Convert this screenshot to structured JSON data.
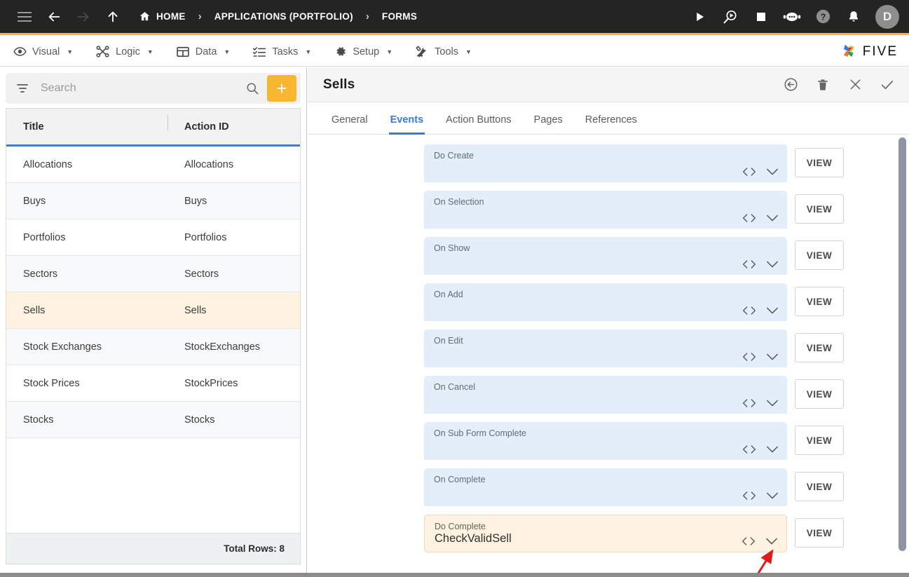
{
  "topbar": {
    "menu_icon": "hamburger-icon",
    "back_icon": "back-arrow-icon",
    "forward_icon": "forward-arrow-icon",
    "up_icon": "up-arrow-icon",
    "breadcrumbs": [
      {
        "label": "HOME",
        "icon": "home-icon"
      },
      {
        "label": "APPLICATIONS (PORTFOLIO)",
        "icon": ""
      },
      {
        "label": "FORMS",
        "icon": ""
      }
    ],
    "separator": "›",
    "right_icons": [
      {
        "name": "run-icon"
      },
      {
        "name": "debug-run-icon"
      },
      {
        "name": "stop-icon"
      },
      {
        "name": "chatbot-icon"
      },
      {
        "name": "help-icon"
      },
      {
        "name": "notifications-bell-icon"
      }
    ],
    "avatar_initial": "D",
    "accent_color": "#f2b731",
    "bar_color": "#242424"
  },
  "menubar": {
    "items": [
      {
        "label": "Visual",
        "icon": "eye-icon"
      },
      {
        "label": "Logic",
        "icon": "nodes-icon"
      },
      {
        "label": "Data",
        "icon": "table-grid-icon"
      },
      {
        "label": "Tasks",
        "icon": "checklist-icon"
      },
      {
        "label": "Setup",
        "icon": "gear-icon"
      },
      {
        "label": "Tools",
        "icon": "tools-icon"
      }
    ],
    "caret": "▼",
    "brand": "FIVE"
  },
  "sidebar": {
    "search": {
      "value": "",
      "placeholder": "Search"
    },
    "add_button_label": "+",
    "columns": [
      "Title",
      "Action ID"
    ],
    "rows": [
      {
        "title": "Allocations",
        "action_id": "Allocations",
        "selected": false
      },
      {
        "title": "Buys",
        "action_id": "Buys",
        "selected": false
      },
      {
        "title": "Portfolios",
        "action_id": "Portfolios",
        "selected": false
      },
      {
        "title": "Sectors",
        "action_id": "Sectors",
        "selected": false
      },
      {
        "title": "Sells",
        "action_id": "Sells",
        "selected": true
      },
      {
        "title": "Stock Exchanges",
        "action_id": "StockExchanges",
        "selected": false
      },
      {
        "title": "Stock Prices",
        "action_id": "StockPrices",
        "selected": false
      },
      {
        "title": "Stocks",
        "action_id": "Stocks",
        "selected": false
      }
    ],
    "footer": "Total Rows: 8"
  },
  "detail": {
    "title": "Sells",
    "actions": [
      {
        "name": "revert-icon"
      },
      {
        "name": "delete-icon"
      },
      {
        "name": "close-icon"
      },
      {
        "name": "save-icon"
      }
    ],
    "tabs": [
      {
        "label": "General",
        "active": false
      },
      {
        "label": "Events",
        "active": true
      },
      {
        "label": "Action Buttons",
        "active": false
      },
      {
        "label": "Pages",
        "active": false
      },
      {
        "label": "References",
        "active": false
      }
    ],
    "view_button_label": "VIEW",
    "events": [
      {
        "label": "Do Create",
        "value": "",
        "highlighted": false
      },
      {
        "label": "On Selection",
        "value": "",
        "highlighted": false
      },
      {
        "label": "On Show",
        "value": "",
        "highlighted": false
      },
      {
        "label": "On Add",
        "value": "",
        "highlighted": false
      },
      {
        "label": "On Edit",
        "value": "",
        "highlighted": false
      },
      {
        "label": "On Cancel",
        "value": "",
        "highlighted": false
      },
      {
        "label": "On Sub Form Complete",
        "value": "",
        "highlighted": false
      },
      {
        "label": "On Complete",
        "value": "",
        "highlighted": false
      },
      {
        "label": "Do Complete",
        "value": "CheckValidSell",
        "highlighted": true
      }
    ],
    "field_icons": {
      "code": "code-brackets-icon",
      "expand": "chevron-down-icon"
    }
  },
  "annotation": {
    "arrow_color": "#e01b1b",
    "points_to": "do-complete-chevron-down-icon"
  }
}
